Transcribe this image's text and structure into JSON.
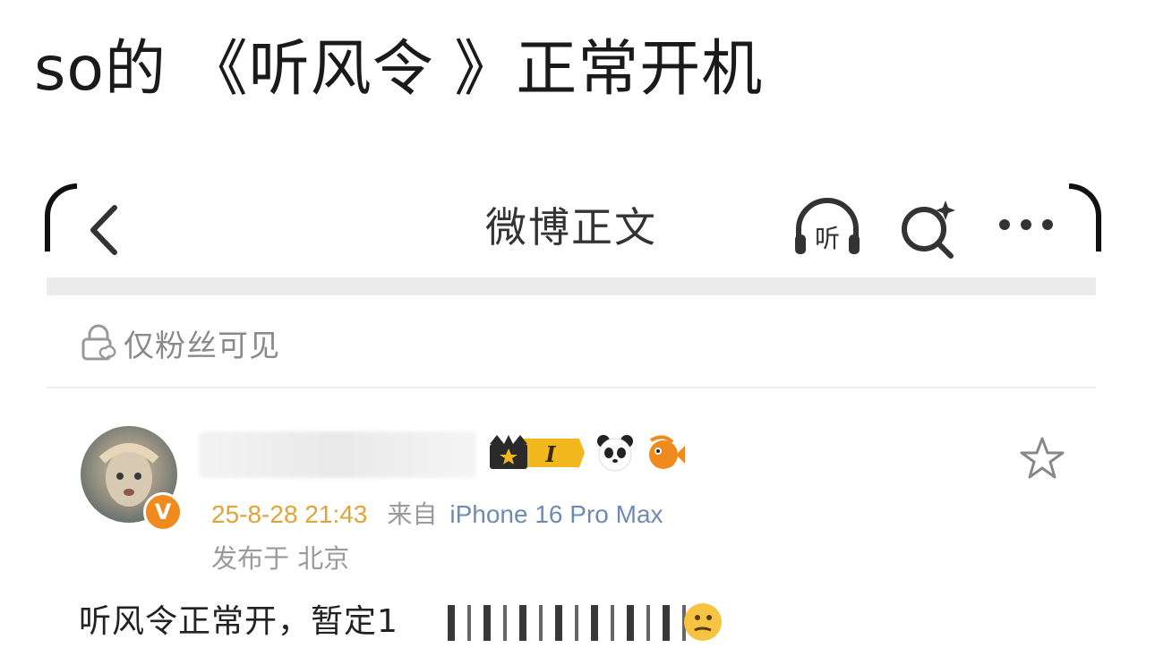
{
  "headline": "so的 《听风令 》正常开机",
  "navbar": {
    "title": "微博正文",
    "listen_label": "听"
  },
  "visibility": {
    "label": "仅粉丝可见"
  },
  "post": {
    "avatar_badge": "V",
    "level_badge": "I",
    "timestamp": "25-8-28 21:43",
    "from_label": "来自",
    "device": "iPhone 16 Pro Max",
    "location": "发布于 北京",
    "text": "听风令正常开，暂定1"
  },
  "colors": {
    "verified": "#f08a1c",
    "timestamp": "#e0a33a",
    "device": "#6f8bb0",
    "muted": "#9a9a9a"
  },
  "icons": [
    "back-icon",
    "listen-icon",
    "search-icon",
    "more-icon",
    "lock-icon",
    "star-icon",
    "crown-badge-icon",
    "panda-icon",
    "fish-icon",
    "thinking-face-icon"
  ]
}
